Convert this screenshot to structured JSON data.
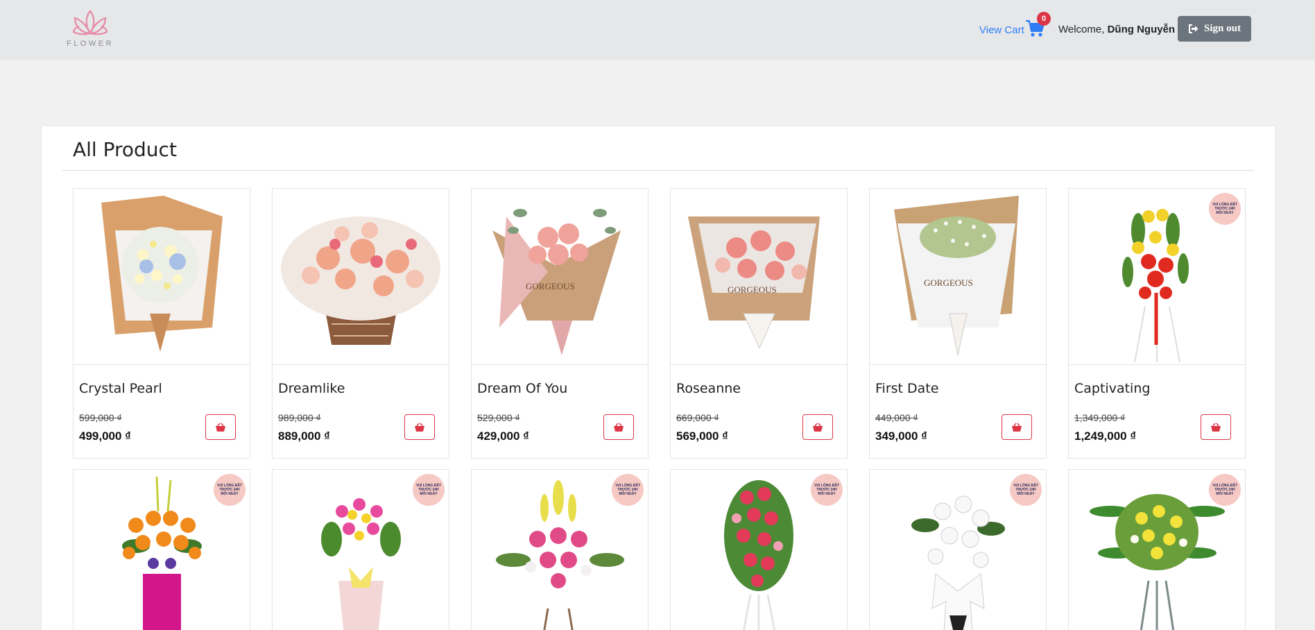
{
  "brand": {
    "logo_text": "FLOWER",
    "accent": "#e58aa6"
  },
  "navbar": {
    "view_cart": "View Cart",
    "cart_icon": "shopping-cart-icon",
    "cart_count": "0",
    "welcome_prefix": "Welcome,",
    "user_name": "Dũng Nguyễn",
    "sign_out": "Sign out",
    "sign_out_icon": "sign-out-icon"
  },
  "main": {
    "title": "All Product",
    "badge_text": "VUI LÒNG ĐẶT TRƯỚC 24H MỖI NGÀY",
    "products": [
      {
        "name": "Crystal Pearl",
        "old_price": "599,000 ₫",
        "new_price": "499,000 ₫"
      },
      {
        "name": "Dreamlike",
        "old_price": "989,000 ₫",
        "new_price": "889,000 ₫"
      },
      {
        "name": "Dream Of You",
        "old_price": "529,000 ₫",
        "new_price": "429,000 ₫"
      },
      {
        "name": "Roseanne",
        "old_price": "669,000 ₫",
        "new_price": "569,000 ₫"
      },
      {
        "name": "First Date",
        "old_price": "449,000 ₫",
        "new_price": "349,000 ₫"
      },
      {
        "name": "Captivating",
        "old_price": "1,349,000 ₫",
        "new_price": "1,249,000 ₫"
      }
    ]
  },
  "colors": {
    "navbar_bg": "#e6e7e9",
    "page_bg": "#f1f1f1",
    "link": "#2f7ef7",
    "danger": "#dc3545",
    "secondary": "#6c757d"
  }
}
